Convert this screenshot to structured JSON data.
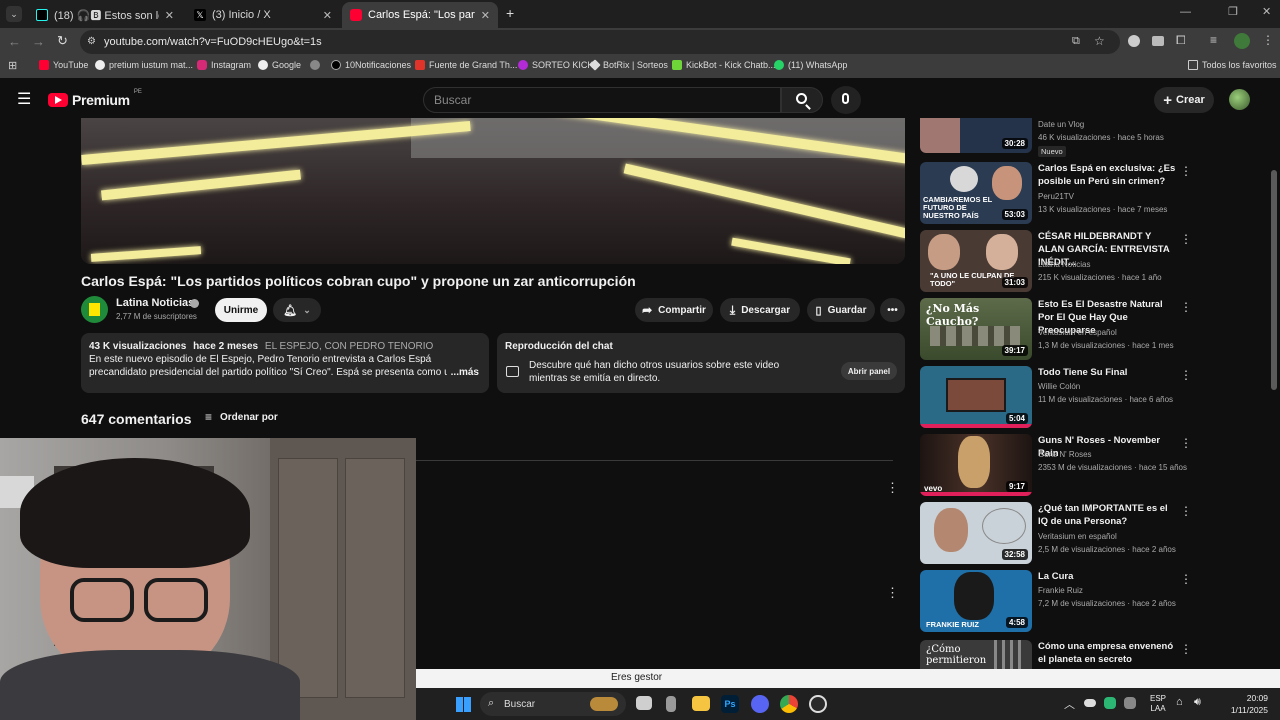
{
  "browser": {
    "tabs": [
      {
        "title": "(18) 🎧🅱 Estos son los stream…",
        "active": false
      },
      {
        "title": "(3) Inicio / X",
        "active": false
      },
      {
        "title": "Carlos Espá: \"Los partidos políti…",
        "active": true
      }
    ],
    "new_tab_label": "+",
    "url": "youtube.com/watch?v=FuOD9cHEUgo&t=1s",
    "bookmarks": [
      "YouTube",
      "pretium iustum mat...",
      "Instagram",
      "Google",
      "10Notificaciones",
      "Fuente de Grand Th...",
      "SORTEO KICK",
      "BotRix | Sorteos",
      "KickBot - Kick Chatb...",
      "(11) WhatsApp"
    ],
    "all_bookmarks": "Todos los favoritos"
  },
  "youtube": {
    "logo": "Premium",
    "region": "PE",
    "search_placeholder": "Buscar",
    "create_label": "Crear"
  },
  "video": {
    "title": "Carlos Espá: \"Los partidos políticos cobran cupo\" y propone un zar anticorrupción",
    "channel": "Latina Noticias",
    "subscribers": "2,77 M de suscriptores",
    "subscribe_label": "Unirme",
    "share": "Compartir",
    "download": "Descargar",
    "save": "Guardar",
    "views": "43 K visualizaciones",
    "age": "hace 2 meses",
    "tags": "EL ESPEJO, CON PEDRO TENORIO",
    "description": "En este nuevo episodio de El Espejo, Pedro Tenorio entrevista a Carlos Espá precandidato presidencial del partido político \"Sí Creo\". Espá se presenta como un líder dispuesto a ir",
    "more": "...más",
    "chat_title": "Reproducción del chat",
    "chat_text": "Descubre qué han dicho otros usuarios sobre este video mientras se emitía en directo.",
    "chat_button": "Abrir panel",
    "comments_count": "647 comentarios",
    "sort_label": "Ordenar por"
  },
  "recommendations": [
    {
      "title": "",
      "channel": "Date un Vlog",
      "meta": "46 K visualizaciones · hace 5 horas",
      "badge": "Nuevo",
      "duration": "30:28",
      "thumb": "#24324a"
    },
    {
      "title": "Carlos Espá en exclusiva: ¿Es posible un Perú sin crimen?",
      "channel": "Peru21TV",
      "meta": "13 K visualizaciones · hace 7 meses",
      "duration": "53:03",
      "thumb": "#2a3b52"
    },
    {
      "title": "CÉSAR HILDEBRANDT Y ALAN GARCÍA: ENTREVISTA INÉDIT...",
      "channel": "Latina Noticias",
      "meta": "215 K visualizaciones · hace 1 año",
      "duration": "31:03",
      "thumb": "#4a3a34"
    },
    {
      "title": "Esto Es El Desastre Natural Por El Que Hay Que Preocuparse",
      "channel": "Veritasium en español",
      "meta": "1,3 M de visualizaciones · hace 1 mes",
      "duration": "39:17",
      "thumb": "#4c5a3a"
    },
    {
      "title": "Todo Tiene Su Final",
      "channel": "Willie Colón",
      "meta": "11 M de visualizaciones · hace 6 años",
      "duration": "5:04",
      "thumb": "#2a6a86"
    },
    {
      "title": "Guns N' Roses - November Rain",
      "channel": "Guns N' Roses",
      "meta": "2353 M de visualizaciones · hace 15 años",
      "duration": "9:17",
      "thumb": "#3a2a24"
    },
    {
      "title": "¿Qué tan IMPORTANTE es el IQ de una Persona?",
      "channel": "Veritasium en español",
      "meta": "2,5 M de visualizaciones · hace 2 años",
      "duration": "32:58",
      "thumb": "#7b8a96"
    },
    {
      "title": "La Cura",
      "channel": "Frankie Ruiz",
      "meta": "7,2 M de visualizaciones · hace 2 años",
      "duration": "4:58",
      "thumb": "#1f6fa8"
    },
    {
      "title": "Cómo una empresa envenenó el planeta en secreto",
      "channel": "",
      "meta": "",
      "duration": "",
      "thumb": "#3a3a3a"
    }
  ],
  "thumb_texts": {
    "cambiaremos": "CAMBIAREMOS EL FUTURO DE NUESTRO PAÍS",
    "culpan": "\"A UNO LE CULPAN DE TODO\"",
    "caucho": "¿No Más Caucho?",
    "frankie": "FRANKIE RUIZ",
    "como": "¿Cómo permitieron"
  },
  "notification": "Eres gestor",
  "taskbar": {
    "search": "Buscar",
    "lang": "ESP",
    "lang2": "LAA",
    "time": "20:09",
    "date": "1/11/2025"
  },
  "colors": {
    "accent_red": "#ff0033",
    "bg": "#0f0f0f",
    "chip": "#272727"
  }
}
